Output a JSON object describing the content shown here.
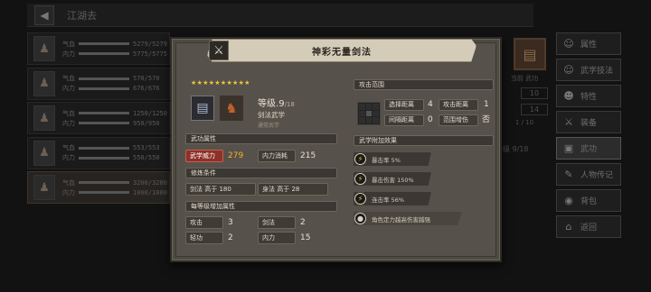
{
  "background": {
    "top_title": "江湖去",
    "party": [
      {
        "hp_label": "气血",
        "mp_label": "内力",
        "hp": "5279/5279",
        "mp": "5775/5775",
        "icon": "person"
      },
      {
        "hp_label": "气血",
        "mp_label": "内力",
        "hp": "570/570",
        "mp": "676/676",
        "icon": "person"
      },
      {
        "hp_label": "气血",
        "mp_label": "内力",
        "hp": "1250/1250",
        "mp": "950/950",
        "icon": "person"
      },
      {
        "hp_label": "气血",
        "mp_label": "内力",
        "hp": "553/553",
        "mp": "550/550",
        "icon": "person"
      },
      {
        "hp_label": "气血",
        "mp_label": "内力",
        "hp": "3200/3200",
        "mp": "1000/1000",
        "icon": "person"
      }
    ],
    "sidebar": [
      {
        "label": "属性",
        "icon": "attributes-icon"
      },
      {
        "label": "武学技法",
        "icon": "martial-arts-icon"
      },
      {
        "label": "特性",
        "icon": "traits-icon"
      },
      {
        "label": "装备",
        "icon": "equipment-icon"
      },
      {
        "label": "武功",
        "icon": "skills-icon"
      },
      {
        "label": "人物传记",
        "icon": "biography-icon"
      },
      {
        "label": "背包",
        "icon": "bag-icon"
      },
      {
        "label": "返回",
        "icon": "return-icon"
      }
    ],
    "right_panel": {
      "text": "当前 武功",
      "box1": "10",
      "box2": "14",
      "frac": "1 / 10",
      "level_text": "等级 9/18"
    }
  },
  "modal": {
    "title": "神彩无量剑法",
    "stars": "★★★★★★★★★★",
    "level_label": "等级",
    "level_value": "9",
    "level_max": "/18",
    "category": "剑法武学",
    "subcategory": "通常武学",
    "attr_header": "武功属性",
    "attrs": [
      {
        "label": "武学威力",
        "value": "279",
        "highlight": true
      },
      {
        "label": "内力消耗",
        "value": "215",
        "highlight": false
      }
    ],
    "req_header": "修炼条件",
    "reqs": [
      {
        "label": "剑法 高于 180"
      },
      {
        "label": "身法 高于 28"
      }
    ],
    "bonus_header": "每等级增加属性",
    "bonuses": [
      {
        "label": "攻击",
        "value": "3"
      },
      {
        "label": "剑法",
        "value": "2"
      },
      {
        "label": "轻功",
        "value": "2"
      },
      {
        "label": "内力",
        "value": "15"
      }
    ],
    "range_header": "攻击范围",
    "ranges": [
      {
        "label": "选择距离",
        "value": "4"
      },
      {
        "label": "攻击距离",
        "value": "1"
      },
      {
        "label": "间隔距离",
        "value": "0"
      },
      {
        "label": "范围增伤",
        "value": "否"
      }
    ],
    "effects_header": "武学附加效果",
    "effects": [
      {
        "text": "暴击率 5%",
        "icon": "bolt"
      },
      {
        "text": "暴击伤害 150%",
        "icon": "bolt"
      },
      {
        "text": "连击率 56%",
        "icon": "bolt"
      },
      {
        "text": "角色定力越高伤害越强",
        "icon": "dot"
      }
    ]
  }
}
